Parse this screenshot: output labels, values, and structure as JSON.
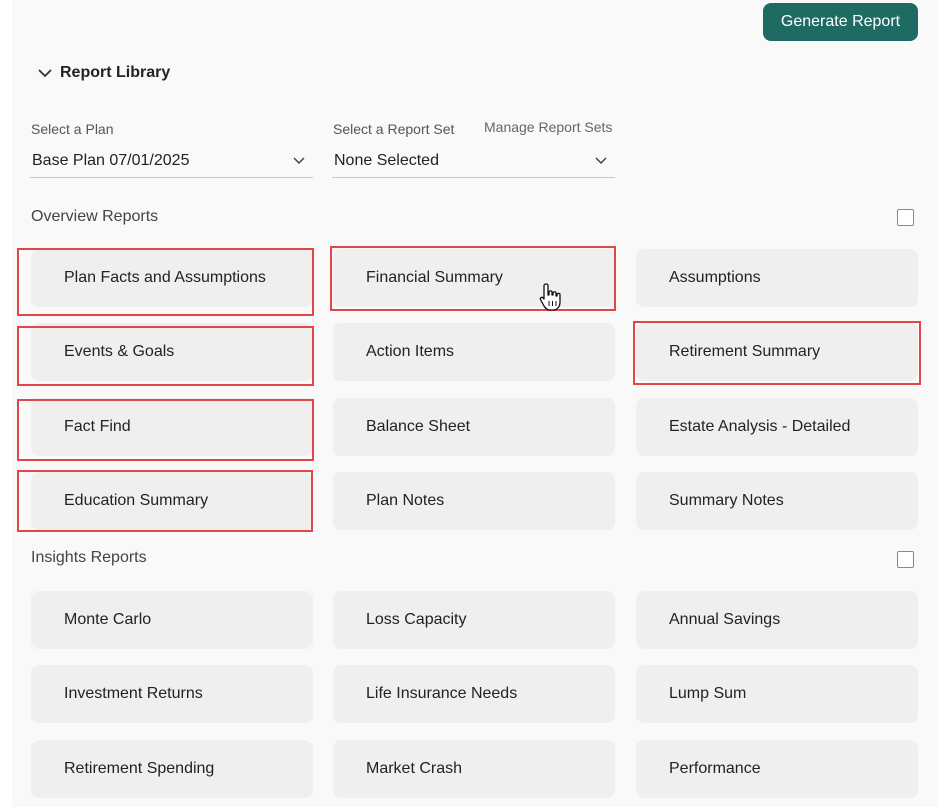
{
  "header": {
    "generate_label": "Generate Report"
  },
  "library": {
    "title": "Report Library"
  },
  "plan_select": {
    "label": "Select a Plan",
    "value": "Base Plan 07/01/2025"
  },
  "set_select": {
    "label": "Select a Report Set",
    "value": "None Selected"
  },
  "manage_link": "Manage Report Sets",
  "overview": {
    "title": "Overview Reports",
    "tiles": [
      "Plan Facts and Assumptions",
      "Financial Summary",
      "Assumptions",
      "Events & Goals",
      "Action Items",
      "Retirement Summary",
      "Fact Find",
      "Balance Sheet",
      "Estate Analysis - Detailed",
      "Education Summary",
      "Plan Notes",
      "Summary Notes"
    ]
  },
  "insights": {
    "title": "Insights Reports",
    "tiles": [
      "Monte Carlo",
      "Loss Capacity",
      "Annual Savings",
      "Investment Returns",
      "Life Insurance Needs",
      "Lump Sum",
      "Retirement Spending",
      "Market Crash",
      "Performance"
    ]
  },
  "colors": {
    "accent": "#1f6b63",
    "highlight": "#e0464a",
    "tile_bg": "#efefef"
  }
}
